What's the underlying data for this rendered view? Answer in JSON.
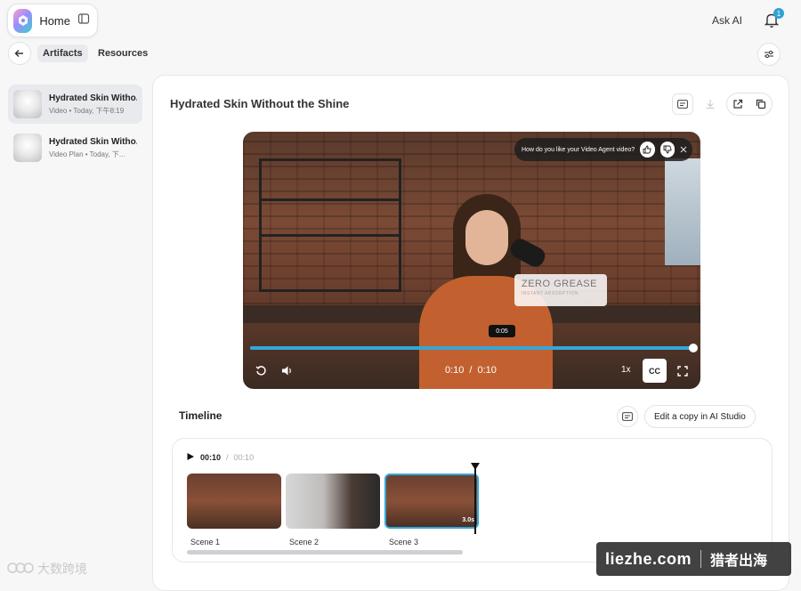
{
  "header": {
    "home_label": "Home",
    "ask_ai_label": "Ask AI",
    "notification_count": "1"
  },
  "nav": {
    "tabs": [
      {
        "label": "Artifacts",
        "active": true
      },
      {
        "label": "Resources",
        "active": false
      }
    ]
  },
  "sidebar": {
    "items": [
      {
        "title": "Hydrated Skin Witho...",
        "subtitle": "Video • Today, 下午8:19",
        "selected": true
      },
      {
        "title": "Hydrated Skin Witho...",
        "subtitle": "Video Plan • Today, 下...",
        "selected": false
      }
    ]
  },
  "main": {
    "title": "Hydrated Skin Without the Shine"
  },
  "video": {
    "feedback_question": "How do you like your Video Agent video?",
    "overlay_sign": "ZERO GREASE",
    "overlay_sign_sub": "INSTANT ABSORPTION",
    "hover_time": "0:05",
    "current_time": "0:10",
    "time_separator": "/",
    "total_time": "0:10",
    "progress": 1.0,
    "speed_label": "1x",
    "cc_label": "CC"
  },
  "timeline": {
    "title": "Timeline",
    "edit_copy_label": "Edit a copy in AI Studio",
    "current_time": "00:10",
    "separator": "/",
    "total_time": "00:10",
    "scenes": [
      {
        "label": "Scene 1",
        "duration": "",
        "selected": false
      },
      {
        "label": "Scene 2",
        "duration": "",
        "selected": false
      },
      {
        "label": "Scene 3",
        "duration": "3.0s",
        "selected": true
      }
    ]
  },
  "watermarks": {
    "left": "大数跨境",
    "right_site": "liezhe.com",
    "right_name": "猎者出海"
  },
  "colors": {
    "accent": "#35a6d8",
    "badge": "#2fa3d6"
  }
}
